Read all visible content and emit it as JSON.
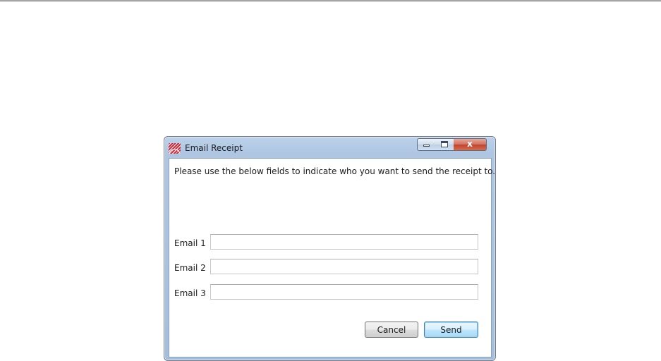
{
  "dialog": {
    "title": "Email Receipt",
    "instruction": "Please use the below fields to indicate who you want to send the receipt to.",
    "fields": [
      {
        "label": "Email 1",
        "value": ""
      },
      {
        "label": "Email 2",
        "value": ""
      },
      {
        "label": "Email 3",
        "value": ""
      }
    ],
    "buttons": {
      "cancel": "Cancel",
      "send": "Send"
    },
    "window_controls": {
      "close_glyph": "x"
    }
  },
  "icons": {
    "app": "app-logo-icon",
    "minimize": "minimize-icon",
    "maximize": "maximize-icon",
    "close": "close-icon"
  },
  "colors": {
    "title_bar": "#aec6e2",
    "close_button": "#c0442d",
    "default_button_border": "#3c7fb1"
  }
}
